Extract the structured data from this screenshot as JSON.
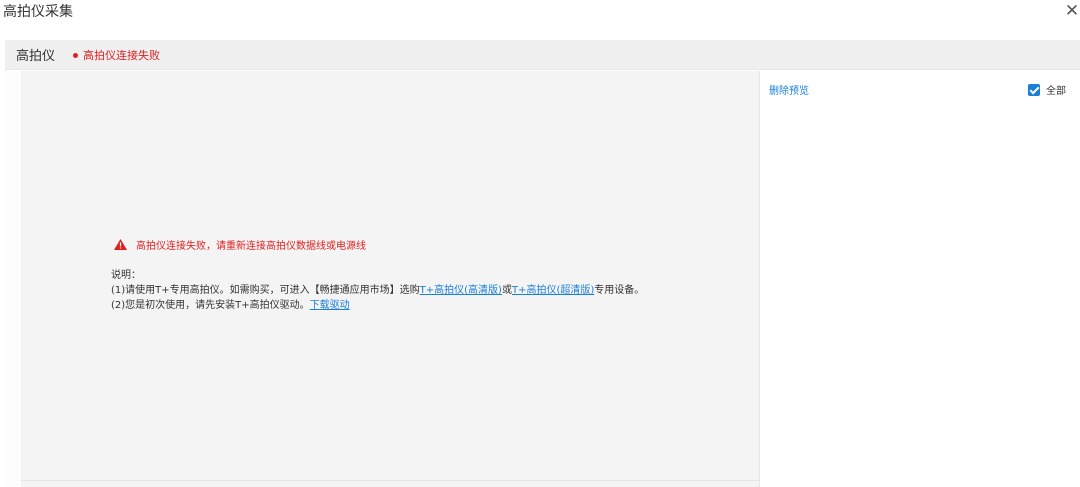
{
  "dialog": {
    "title": "高拍仪采集",
    "close_icon": "close-icon"
  },
  "section": {
    "title": "高拍仪",
    "status": "高拍仪连接失败",
    "status_color": "#e02020"
  },
  "preview": {
    "error_message": "高拍仪连接失败，请重新连接高拍仪数据线或电源线",
    "error_icon": "warning-triangle-icon",
    "notes_heading": "说明：",
    "note1_prefix": "(1)请使用T+专用高拍仪。如需购买，可进入【畅捷通应用市场】选购",
    "note1_link1": "T+高拍仪(高清版)",
    "note1_middle": "或",
    "note1_link2": "T+高拍仪(超清版)",
    "note1_suffix": "专用设备。",
    "note2_prefix": "(2)您是初次使用，请先安装T+高拍仪驱动。",
    "note2_link": "下载驱动"
  },
  "side": {
    "delete_preview": "删除预览",
    "select_all": "全部",
    "select_all_checked": true
  },
  "colors": {
    "link": "#1a7fd7",
    "error": "#e02020",
    "panel": "#f4f4f4"
  }
}
